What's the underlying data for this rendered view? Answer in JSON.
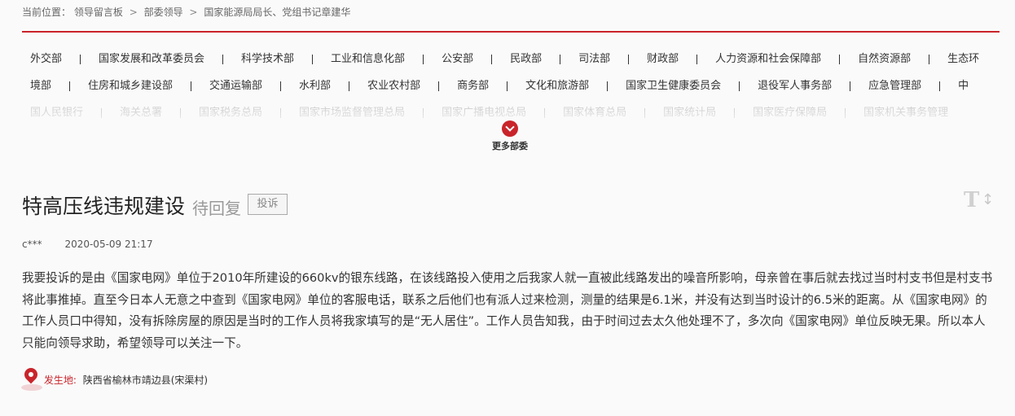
{
  "breadcrumb": {
    "prefix": "当前位置：",
    "items": [
      "领导留言板",
      "部委领导",
      "国家能源局局长、党组书记章建华"
    ],
    "separator": ">"
  },
  "departments": {
    "row1": [
      "外交部",
      "国家发展和改革委员会",
      "科学技术部",
      "工业和信息化部",
      "公安部",
      "民政部",
      "司法部",
      "财政部",
      "人力资源和社会保障部",
      "自然资源部",
      "生态环"
    ],
    "row2": [
      "境部",
      "住房和城乡建设部",
      "交通运输部",
      "水利部",
      "农业农村部",
      "商务部",
      "文化和旅游部",
      "国家卫生健康委员会",
      "退役军人事务部",
      "应急管理部",
      "中"
    ],
    "row3": [
      "国人民银行",
      "海关总署",
      "国家税务总局",
      "国家市场监督管理总局",
      "国家广播电视总局",
      "国家体育总局",
      "国家统计局",
      "国家医疗保障局",
      "国家机关事务管理"
    ],
    "more_label": "更多部委"
  },
  "message": {
    "title": "特高压线违规建设",
    "status": "待回复",
    "type_badge": "投诉",
    "font_toggle_icon": "T↕",
    "author": "c***",
    "time": "2020-05-09 21:17",
    "content": "我要投诉的是由《国家电网》单位于2010年所建设的660kv的银东线路，在该线路投入使用之后我家人就一直被此线路发出的噪音所影响，母亲曾在事后就去找过当时村支书但是村支书将此事推掉。直至今日本人无意之中查到《国家电网》单位的客服电话，联系之后他们也有派人过来检测，测量的结果是6.1米，并没有达到当时设计的6.5米的距离。从《国家电网》的工作人员口中得知，没有拆除房屋的原因是当时的工作人员将我家填写的是“无人居住”。工作人员告知我，由于时间过去太久他处理不了，多次向《国家电网》单位反映无果。所以本人只能向领导求助，希望领导可以关注一下。",
    "location_label": "发生地:",
    "location_value": "陕西省榆林市靖边县(宋渠村)"
  },
  "colors": {
    "accent": "#c9242b",
    "background": "#fafafa"
  },
  "icons": {
    "more": "chevron-down-icon",
    "location": "map-pin-icon",
    "font_size": "font-size-toggle-icon"
  }
}
